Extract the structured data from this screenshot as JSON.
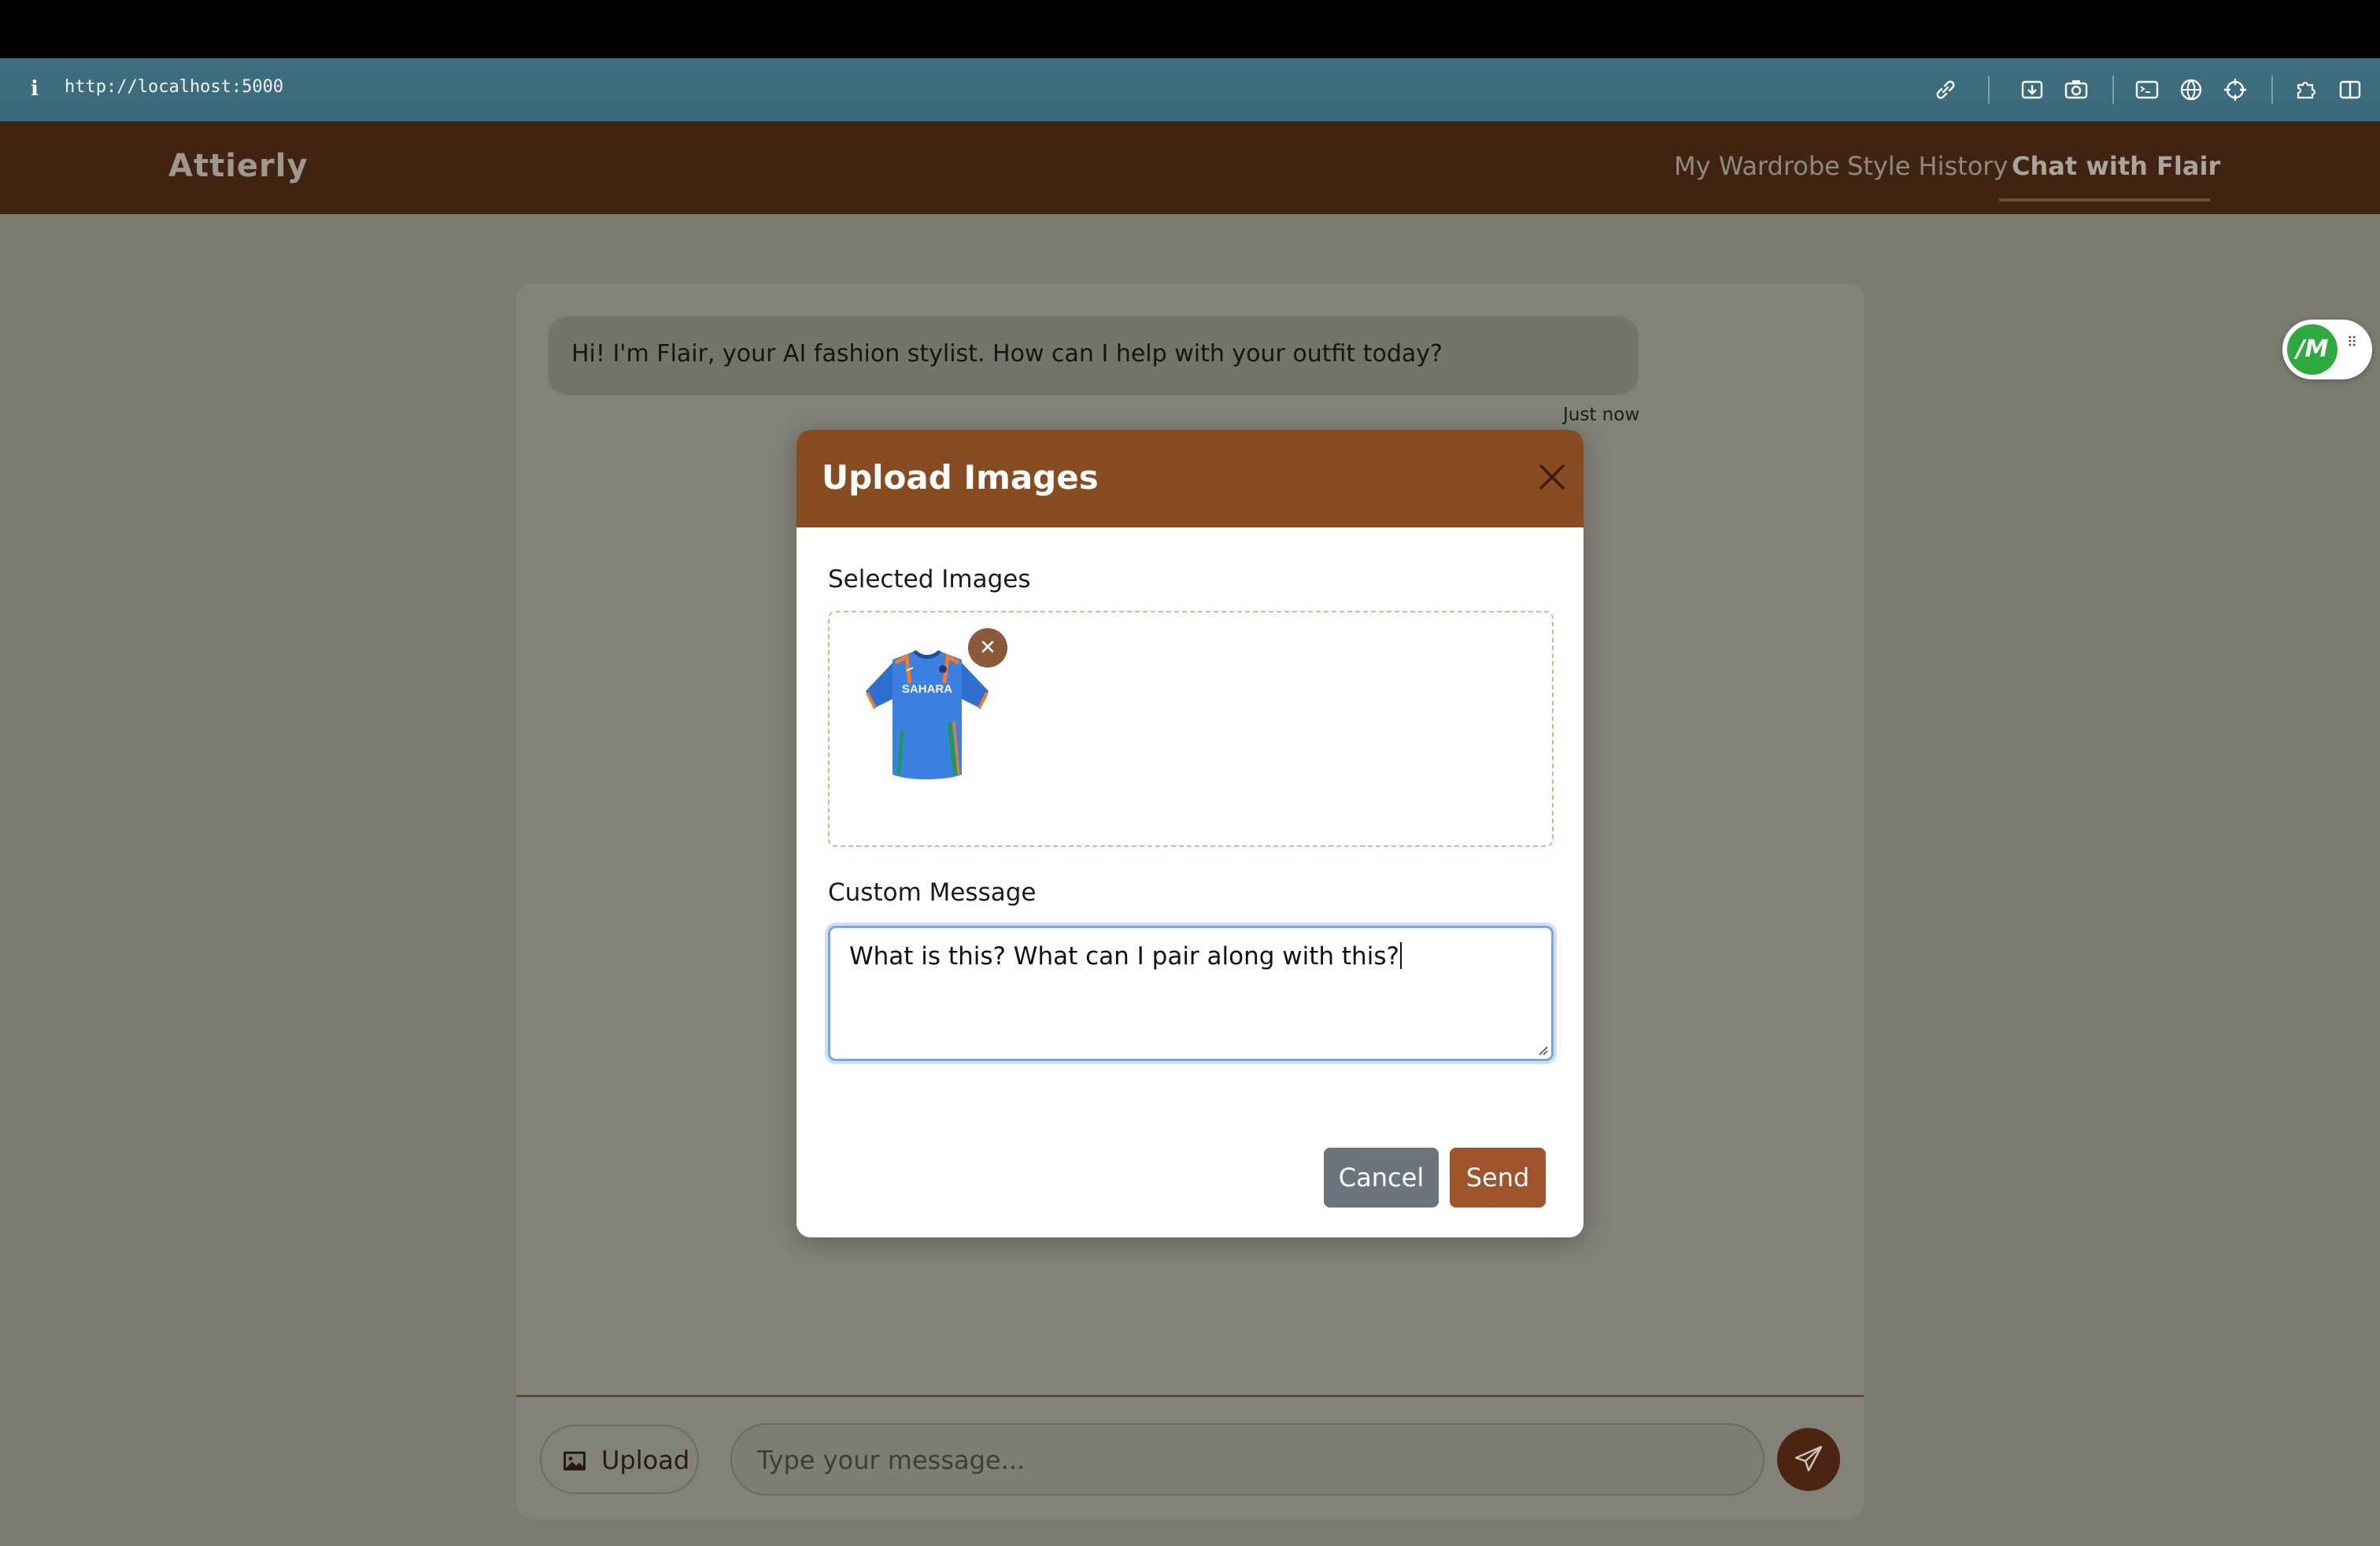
{
  "browser": {
    "url": "http://localhost:5000",
    "toolbar_icons": [
      "link-icon",
      "download-icon",
      "camera-icon",
      "terminal-icon",
      "globe-icon",
      "crosshair-icon",
      "extensions-icon",
      "split-view-icon"
    ]
  },
  "header": {
    "brand": "Attierly",
    "nav": [
      "My Wardrobe",
      "Style History",
      "Chat with Flair"
    ],
    "active_nav": "Chat with Flair"
  },
  "extension": {
    "logo_text": "/M"
  },
  "chat": {
    "bot_message": "Hi! I'm Flair, your AI fashion stylist. How can I help with your outfit today?",
    "timestamp": "Just now",
    "upload_label": "Upload",
    "input_placeholder": "Type your message..."
  },
  "modal": {
    "title": "Upload Images",
    "selected_label": "Selected Images",
    "thumbnail_text": "SAHARA",
    "message_label": "Custom Message",
    "message_value": "What is this? What can I pair along with this?",
    "cancel_label": "Cancel",
    "send_label": "Send"
  },
  "colors": {
    "header_bg": "#412311",
    "modal_header": "#874c22",
    "send_button": "#a0542c",
    "cancel_button": "#6c757d",
    "browser_bar": "#3e6f80"
  }
}
